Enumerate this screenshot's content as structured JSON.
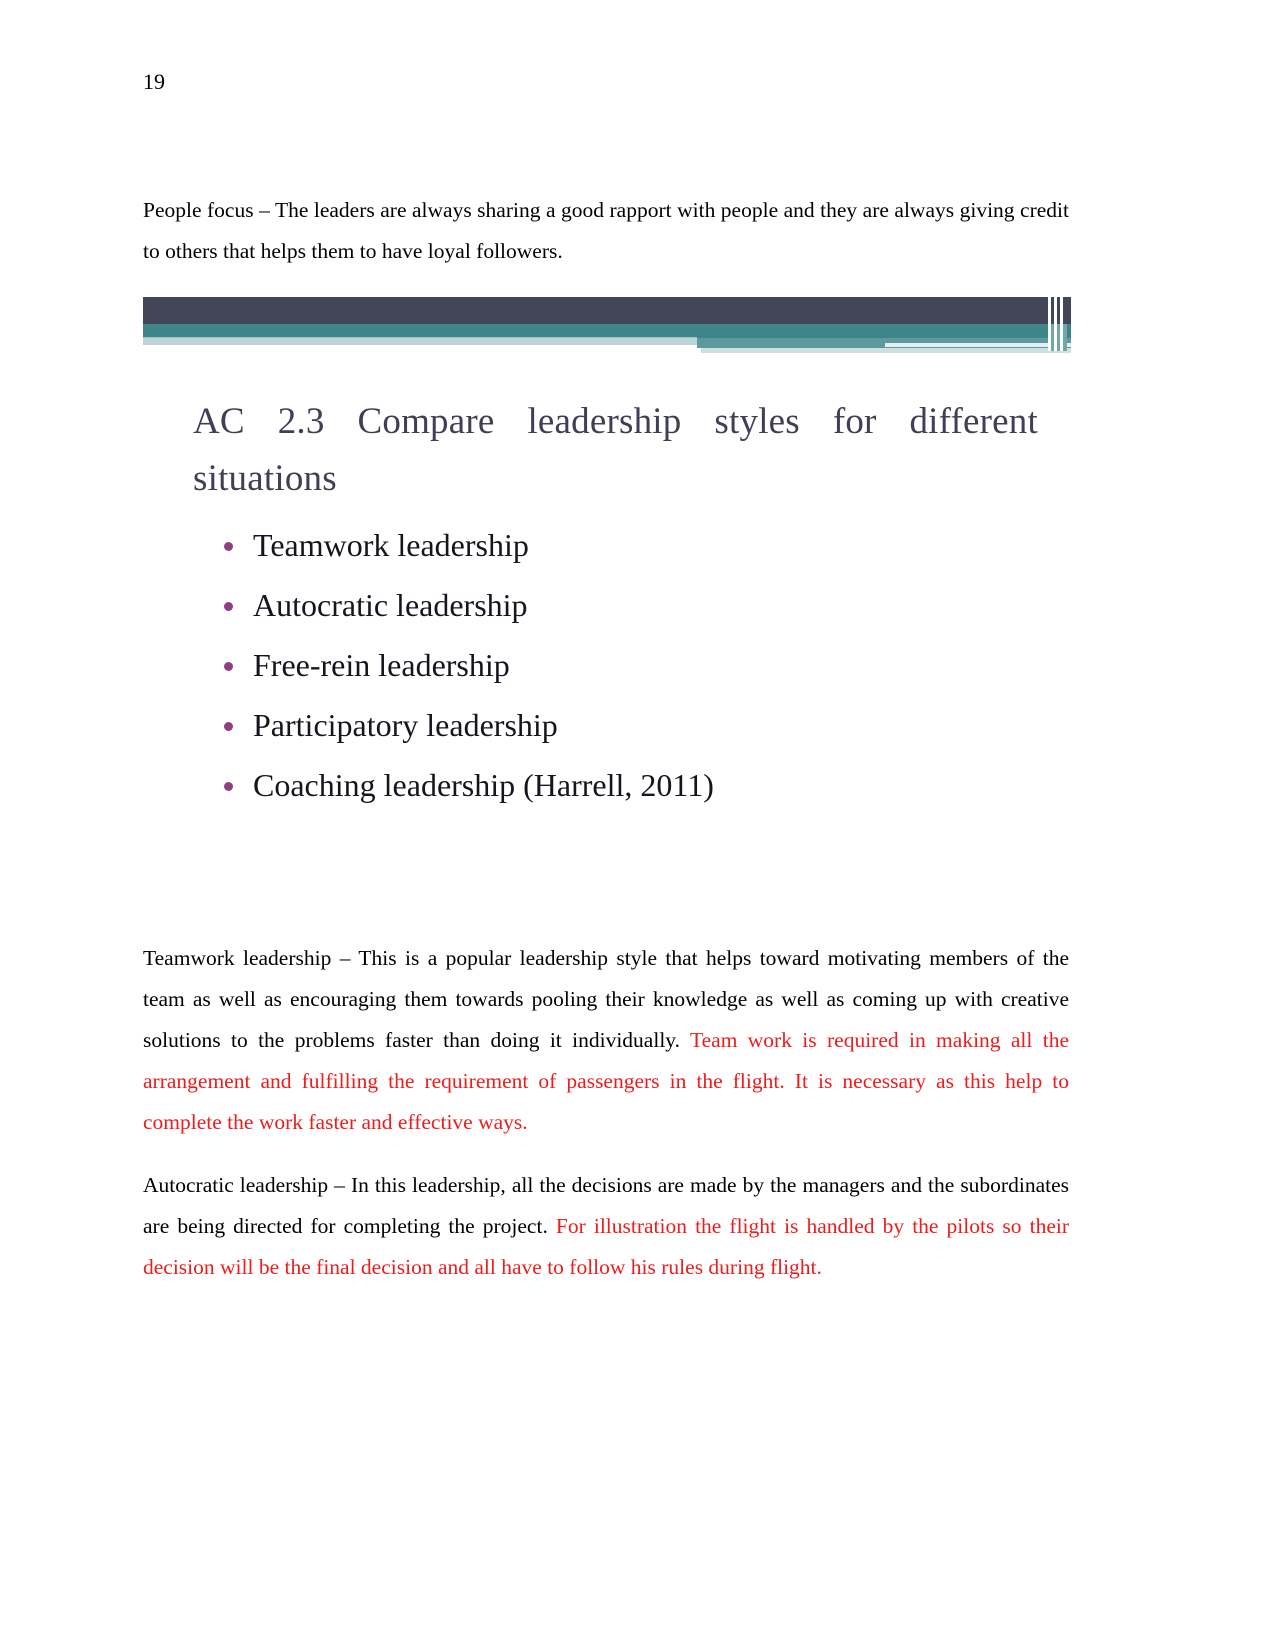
{
  "page": {
    "number": "19"
  },
  "paragraphs": {
    "people_focus": "People focus – The leaders are always sharing a good rapport with people and they are always giving credit to others that helps them to have loyal followers.",
    "teamwork_black": "Teamwork leadership – This is a popular leadership style that helps toward motivating members of the team as well as encouraging them towards pooling their knowledge as well as coming up with creative solutions to the problems faster than doing it individually. ",
    "teamwork_red": "Team work is required in making all the arrangement and fulfilling the requirement of passengers in the flight. It is necessary as this help to complete the work faster and effective ways.",
    "autocratic_black": "Autocratic leadership – In this leadership, all the decisions are made by the managers and the subordinates are being directed for completing the project. ",
    "autocratic_red": "For illustration the flight is handled by the pilots so their decision will be the final decision and all have to follow his rules during flight."
  },
  "slide": {
    "heading_line1": "AC 2.3 Compare leadership styles for different",
    "heading_line2": "situations",
    "bullets": [
      "Teamwork leadership",
      "Autocratic leadership",
      "Free-rein leadership",
      "Participatory leadership",
      "Coaching leadership (Harrell, 2011)"
    ]
  },
  "colors": {
    "red_text": "#ee1c1c",
    "banner_dark": "#434659",
    "banner_teal": "#3f8488",
    "banner_pale": "#bcd4d6",
    "heading_text": "#3f3f55",
    "bullet_dot": "#8e3f80"
  }
}
